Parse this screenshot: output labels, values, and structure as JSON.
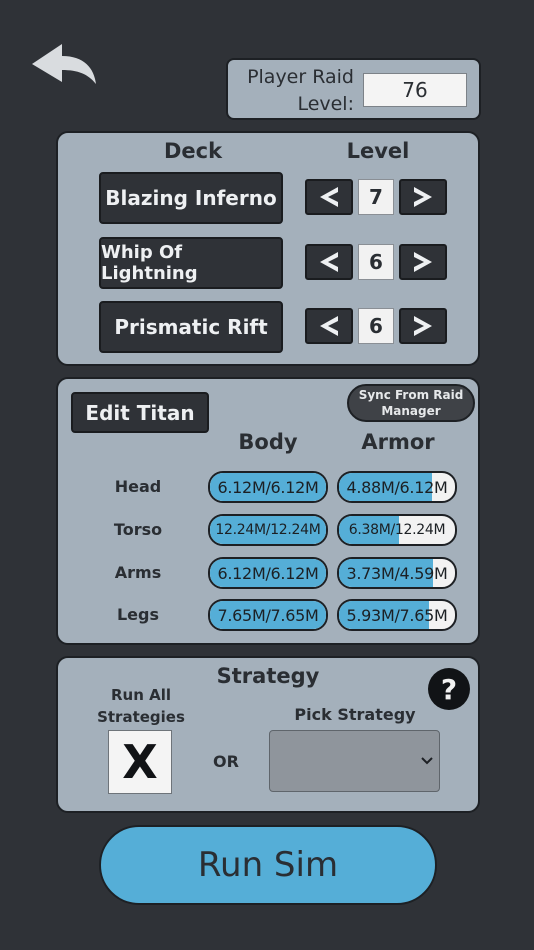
{
  "header": {
    "back_icon": "back-arrow-icon",
    "raid_level_label_line1": "Player Raid",
    "raid_level_label_line2": "Level:",
    "raid_level_value": "76"
  },
  "deck": {
    "header": "Deck",
    "level_header": "Level",
    "cards": [
      {
        "name": "Blazing Inferno",
        "level": "7"
      },
      {
        "name": "Whip Of Lightning",
        "level": "6"
      },
      {
        "name": "Prismatic Rift",
        "level": "6"
      }
    ]
  },
  "titan": {
    "edit_label": "Edit Titan",
    "sync_label_line1": "Sync From Raid",
    "sync_label_line2": "Manager",
    "body_header": "Body",
    "armor_header": "Armor",
    "parts": [
      {
        "label": "Head",
        "body": "6.12M/6.12M",
        "body_fraction": 1.0,
        "armor": "4.88M/6.12M",
        "armor_fraction": 0.8
      },
      {
        "label": "Torso",
        "body": "12.24M/12.24M",
        "body_fraction": 1.0,
        "armor": "6.38M/12.24M",
        "armor_fraction": 0.52
      },
      {
        "label": "Arms",
        "body": "6.12M/6.12M",
        "body_fraction": 1.0,
        "armor": "3.73M/4.59M",
        "armor_fraction": 0.81
      },
      {
        "label": "Legs",
        "body": "7.65M/7.65M",
        "body_fraction": 1.0,
        "armor": "5.93M/7.65M",
        "armor_fraction": 0.78
      }
    ]
  },
  "strategy": {
    "title": "Strategy",
    "run_all_line1": "Run All",
    "run_all_line2": "Strategies",
    "run_all_checked": "X",
    "or_label": "OR",
    "pick_label": "Pick Strategy",
    "pick_value": "",
    "help_icon": "?"
  },
  "run_sim_label": "Run Sim",
  "colors": {
    "background": "#2f3237",
    "panel": "#a4b0bb",
    "accent_blue": "#55aed7",
    "dark_button": "#2f3237"
  }
}
